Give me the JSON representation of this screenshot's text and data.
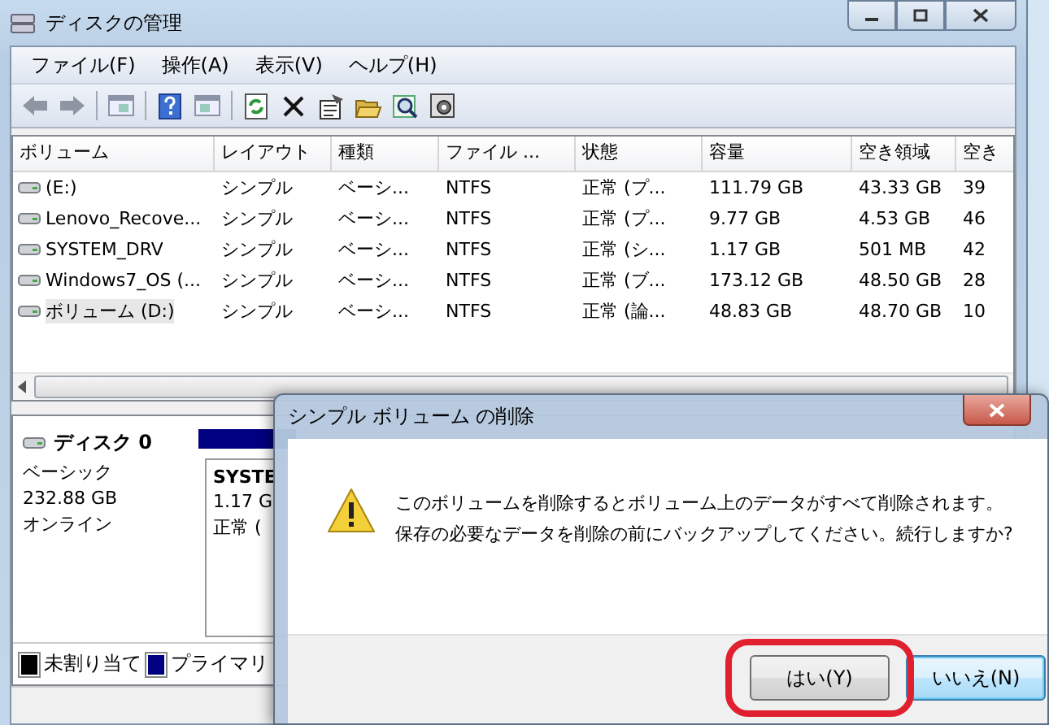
{
  "window": {
    "title": "ディスクの管理"
  },
  "menu": [
    "ファイル(F)",
    "操作(A)",
    "表示(V)",
    "ヘルプ(H)"
  ],
  "table": {
    "columns": [
      "ボリューム",
      "レイアウト",
      "種類",
      "ファイル ...",
      "状態",
      "容量",
      "空き領域",
      "空き"
    ],
    "rows": [
      {
        "cells": [
          "(E:)",
          "シンプル",
          "ベーシ...",
          "NTFS",
          "正常 (プ...",
          "111.79 GB",
          "43.33 GB",
          "39"
        ],
        "selected": false
      },
      {
        "cells": [
          "Lenovo_Recove...",
          "シンプル",
          "ベーシ...",
          "NTFS",
          "正常 (プ...",
          "9.77 GB",
          "4.53 GB",
          "46"
        ],
        "selected": false
      },
      {
        "cells": [
          "SYSTEM_DRV",
          "シンプル",
          "ベーシ...",
          "NTFS",
          "正常 (シ...",
          "1.17 GB",
          "501 MB",
          "42"
        ],
        "selected": false
      },
      {
        "cells": [
          "Windows7_OS (...",
          "シンプル",
          "ベーシ...",
          "NTFS",
          "正常 (ブ...",
          "173.12 GB",
          "48.50 GB",
          "28"
        ],
        "selected": false
      },
      {
        "cells": [
          "ボリューム (D:)",
          "シンプル",
          "ベーシ...",
          "NTFS",
          "正常 (論...",
          "48.83 GB",
          "48.70 GB",
          "10"
        ],
        "selected": true
      }
    ]
  },
  "disk": {
    "name": "ディスク 0",
    "type": "ベーシック",
    "size": "232.88 GB",
    "status": "オンライン",
    "partition": {
      "name": "SYSTE",
      "size": "1.17 G",
      "status": "正常 ("
    }
  },
  "legend": [
    {
      "label": "未割り当て",
      "color": "#000000"
    },
    {
      "label": "プライマリ",
      "color": "#000080"
    }
  ],
  "dialog": {
    "title": "シンプル ボリューム の削除",
    "message": "このボリュームを削除するとボリューム上のデータがすべて削除されます。保存の必要なデータを削除の前にバックアップしてください。続行しますか?",
    "buttons": [
      {
        "label": "はい(Y)",
        "default": false,
        "circled": true
      },
      {
        "label": "いいえ(N)",
        "default": true,
        "circled": false
      }
    ]
  }
}
